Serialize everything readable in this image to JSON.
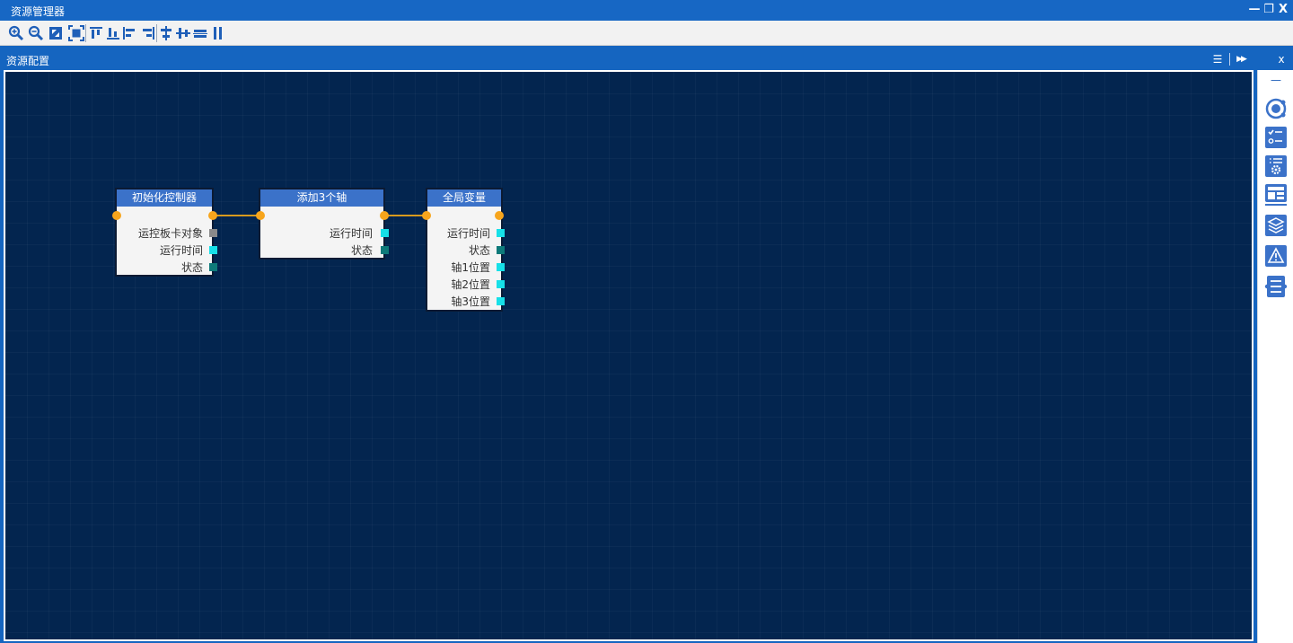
{
  "window": {
    "title": "资源管理器",
    "minimize": "—",
    "restore": "❐",
    "close": "X"
  },
  "toolbar": {
    "buttons": [
      "zoom-in-icon",
      "zoom-out-icon",
      "fit-window-icon",
      "fit-selection-icon",
      "align-top-icon",
      "align-bottom-icon",
      "align-left-icon",
      "align-right-icon",
      "center-horizontal-icon",
      "center-vertical-icon",
      "distribute-horizontal-icon",
      "distribute-vertical-icon"
    ]
  },
  "panel": {
    "title": "资源配置",
    "menu": "☰",
    "expand": "▶▶",
    "close": "x"
  },
  "colors": {
    "canvas_bg": "#03254f",
    "node_header": "#3b72c9",
    "port": "#f7a51c",
    "pin_cyan": "#16e0e8",
    "pin_teal": "#0e7a7a",
    "pin_gray": "#8a8a8a",
    "link": "#d89a1e",
    "accent": "#1565c0"
  },
  "nodes": [
    {
      "title": "初始化控制器",
      "rows": [
        {
          "label": "运控板卡对象",
          "pin": "gray"
        },
        {
          "label": "运行时间",
          "pin": "cyan"
        },
        {
          "label": "状态",
          "pin": "teal"
        }
      ]
    },
    {
      "title": "添加3个轴",
      "rows": [
        {
          "label": "运行时间",
          "pin": "cyan"
        },
        {
          "label": "状态",
          "pin": "teal"
        }
      ]
    },
    {
      "title": "全局变量",
      "rows": [
        {
          "label": "运行时间",
          "pin": "cyan"
        },
        {
          "label": "状态",
          "pin": "teal"
        },
        {
          "label": "轴1位置",
          "pin": "cyan"
        },
        {
          "label": "轴2位置",
          "pin": "cyan"
        },
        {
          "label": "轴3位置",
          "pin": "cyan"
        }
      ]
    }
  ],
  "sidebar": {
    "collapse": "—",
    "buttons": [
      "target-node-icon",
      "checklist-icon",
      "settings-list-icon",
      "template-icon",
      "layers-icon",
      "warning-icon",
      "variable-list-icon"
    ]
  }
}
